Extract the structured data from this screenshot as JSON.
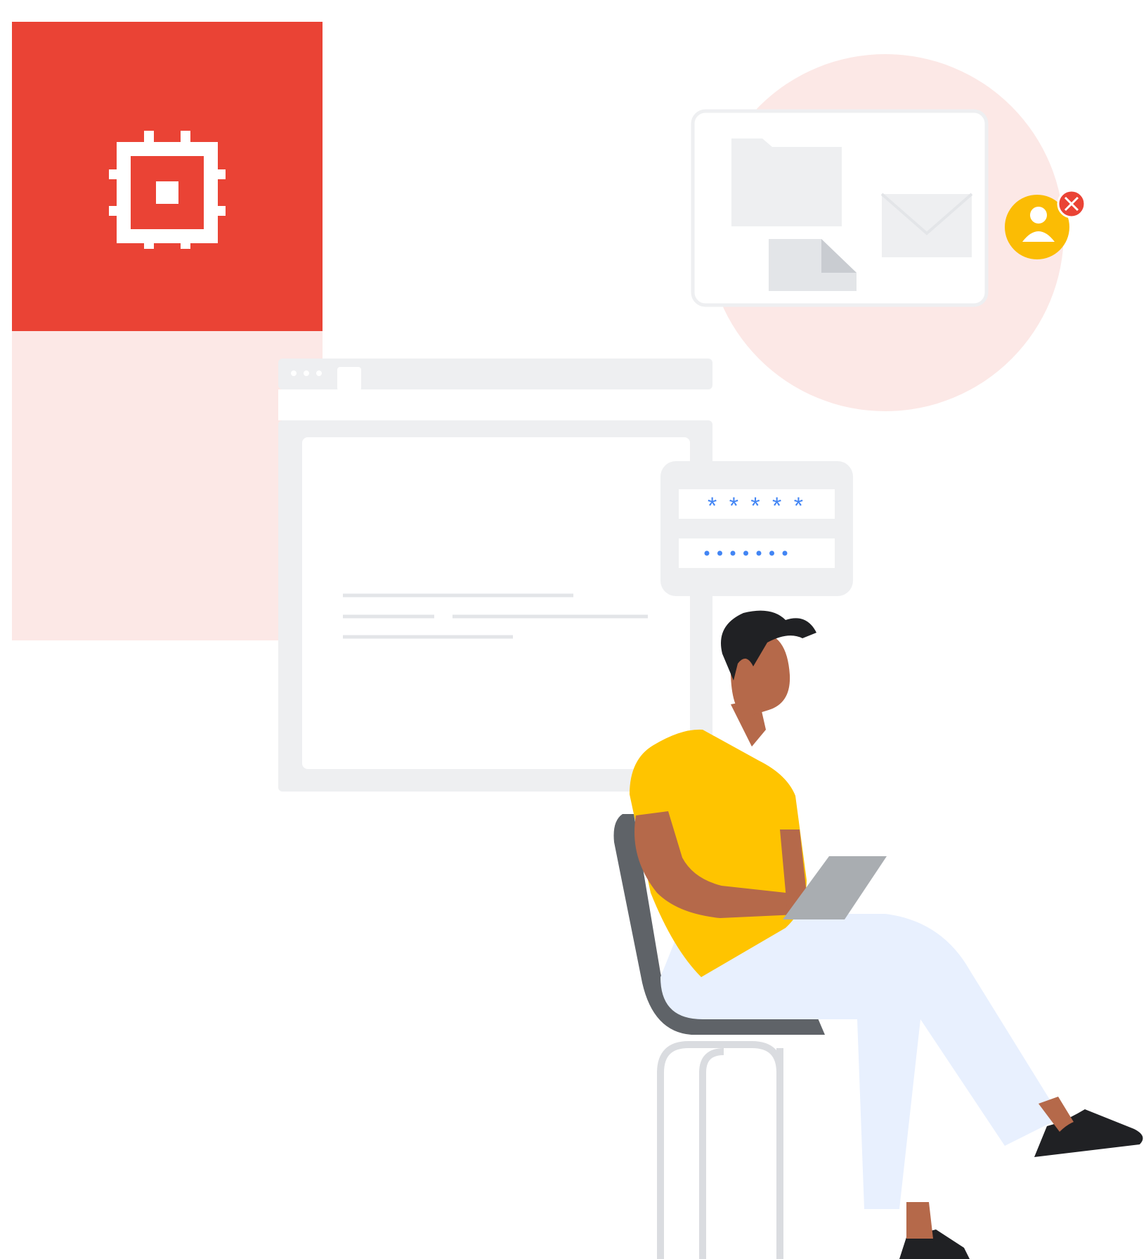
{
  "illustration": {
    "colors": {
      "brand_red": "#EA4335",
      "pale_red": "#FCE8E6",
      "ui_gray": "#EEEFF1",
      "ui_gray_dark": "#E3E5E8",
      "password_blue": "#4285F4",
      "avatar_yellow": "#FBBC04",
      "error_red": "#EA4335",
      "shirt_yellow": "#FFC400",
      "skin": "#B5694A",
      "hair": "#202124",
      "chair_gray": "#5F6368",
      "laptop_gray": "#A9ADB1",
      "pants_white": "#E8F0FE",
      "stool_gray": "#DADCE0"
    },
    "icons": {
      "chip": "chip-icon",
      "avatar": "account-icon",
      "error": "close-icon",
      "folder": "folder-icon",
      "mail": "mail-icon",
      "document": "document-icon"
    },
    "password_field": {
      "username_mask": "* * * * *",
      "password_dots": 7
    }
  }
}
